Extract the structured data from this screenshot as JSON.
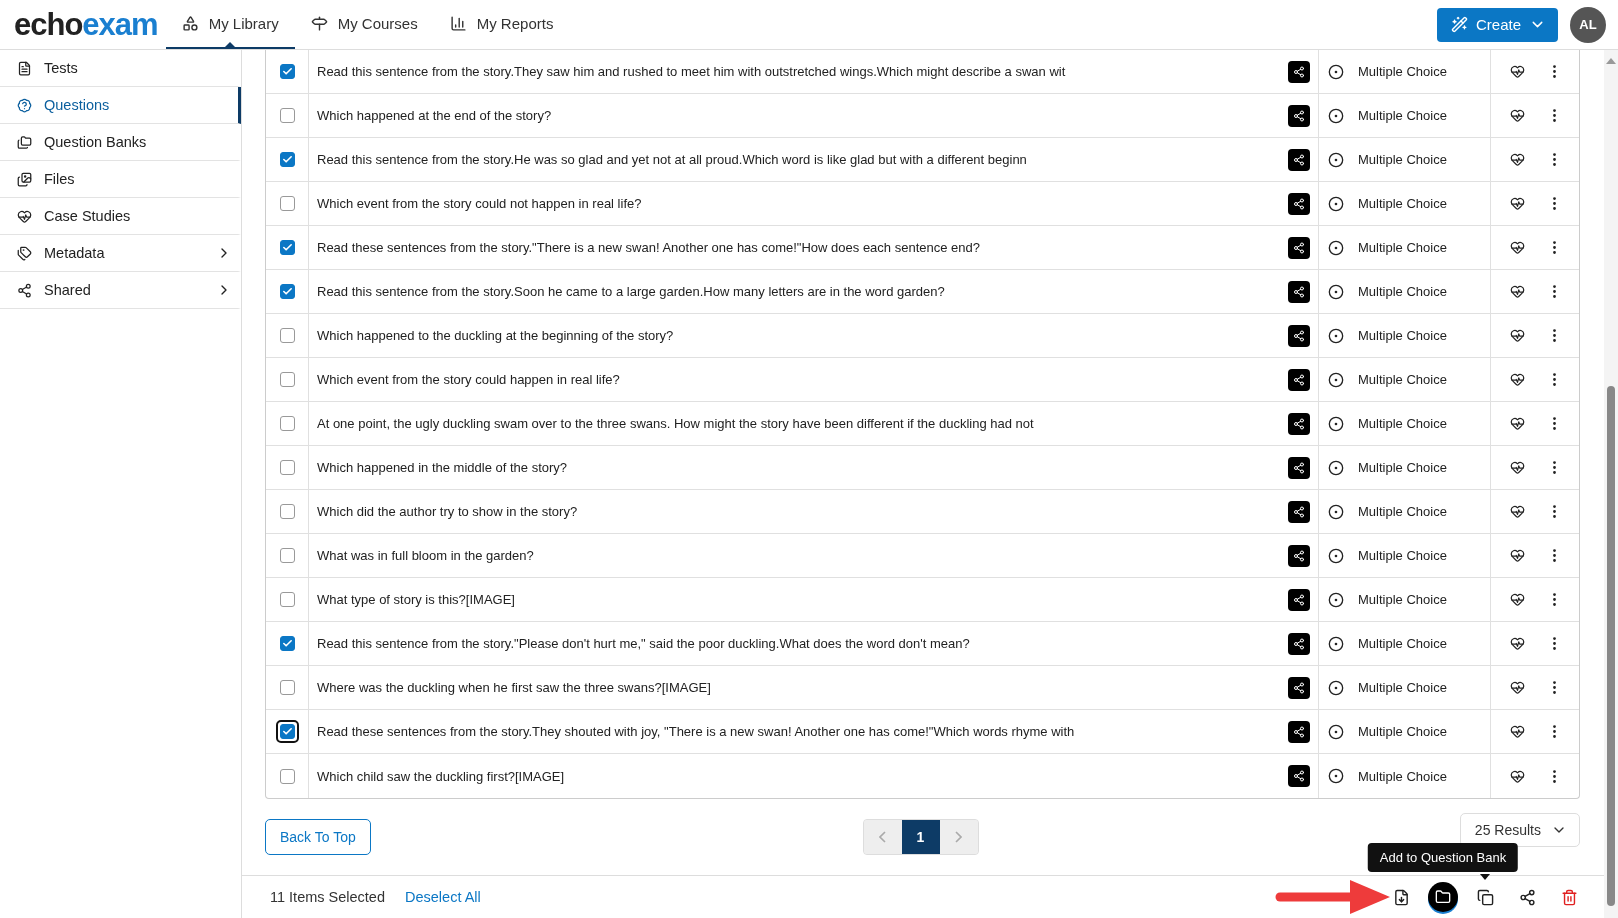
{
  "header": {
    "logo": {
      "part1": "echo",
      "part2": "exam"
    },
    "nav": [
      {
        "label": "My Library",
        "selected": true
      },
      {
        "label": "My Courses",
        "selected": false
      },
      {
        "label": "My Reports",
        "selected": false
      }
    ],
    "create_button": "Create",
    "avatar": "AL"
  },
  "sidebar": {
    "items": [
      {
        "label": "Tests",
        "selected": false,
        "has_submenu": false
      },
      {
        "label": "Questions",
        "selected": true,
        "has_submenu": false
      },
      {
        "label": "Question Banks",
        "selected": false,
        "has_submenu": false
      },
      {
        "label": "Files",
        "selected": false,
        "has_submenu": false
      },
      {
        "label": "Case Studies",
        "selected": false,
        "has_submenu": false
      },
      {
        "label": "Metadata",
        "selected": false,
        "has_submenu": true
      },
      {
        "label": "Shared",
        "selected": false,
        "has_submenu": true
      }
    ]
  },
  "questions": [
    {
      "text": "Read this sentence from the story.They saw him and rushed to meet him with outstretched wings.Which might describe a swan wit",
      "type": "Multiple Choice",
      "checked": true,
      "focused": false
    },
    {
      "text": "Which happened at the end of the story?",
      "type": "Multiple Choice",
      "checked": false,
      "focused": false
    },
    {
      "text": "Read this sentence from the story.He was so glad and yet not at all proud.Which word is like glad but with a different beginn",
      "type": "Multiple Choice",
      "checked": true,
      "focused": false
    },
    {
      "text": "Which event from the story could not happen in real life?",
      "type": "Multiple Choice",
      "checked": false,
      "focused": false
    },
    {
      "text": "Read these sentences from the story.\"There is a new swan! Another one has come!\"How does each sentence end?",
      "type": "Multiple Choice",
      "checked": true,
      "focused": false
    },
    {
      "text": "Read this sentence from the story.Soon he came to a large garden.How many letters are in the word garden?",
      "type": "Multiple Choice",
      "checked": true,
      "focused": false
    },
    {
      "text": "Which happened to the duckling at the beginning of the story?",
      "type": "Multiple Choice",
      "checked": false,
      "focused": false
    },
    {
      "text": "Which event from the story could happen in real life?",
      "type": "Multiple Choice",
      "checked": false,
      "focused": false
    },
    {
      "text": "At one point, the ugly duckling swam over to the three swans. How might the story have been different if the duckling had not",
      "type": "Multiple Choice",
      "checked": false,
      "focused": false
    },
    {
      "text": "Which happened in the middle of the story?",
      "type": "Multiple Choice",
      "checked": false,
      "focused": false
    },
    {
      "text": "Which did the author try to show in the story?",
      "type": "Multiple Choice",
      "checked": false,
      "focused": false
    },
    {
      "text": "What was in full bloom in the garden?",
      "type": "Multiple Choice",
      "checked": false,
      "focused": false
    },
    {
      "text": "What type of story is this?[IMAGE]",
      "type": "Multiple Choice",
      "checked": false,
      "focused": false
    },
    {
      "text": "Read this sentence from the story.\"Please don't hurt me,\" said the poor duckling.What does the word don't mean?",
      "type": "Multiple Choice",
      "checked": true,
      "focused": false
    },
    {
      "text": "Where was the duckling when he first saw the three swans?[IMAGE]",
      "type": "Multiple Choice",
      "checked": false,
      "focused": false
    },
    {
      "text": "Read these sentences from the story.They shouted with joy, \"There is a new swan! Another one has come!\"Which words rhyme with",
      "type": "Multiple Choice",
      "checked": true,
      "focused": true
    },
    {
      "text": "Which child saw the duckling first?[IMAGE]",
      "type": "Multiple Choice",
      "checked": false,
      "focused": false
    }
  ],
  "pagination": {
    "back_to_top": "Back To Top",
    "pages": [
      {
        "label": "1",
        "selected": true
      }
    ],
    "results": "25 Results"
  },
  "footer": {
    "selected_count": "11 Items Selected",
    "deselect_all": "Deselect All",
    "tooltip": "Add to Question Bank"
  }
}
